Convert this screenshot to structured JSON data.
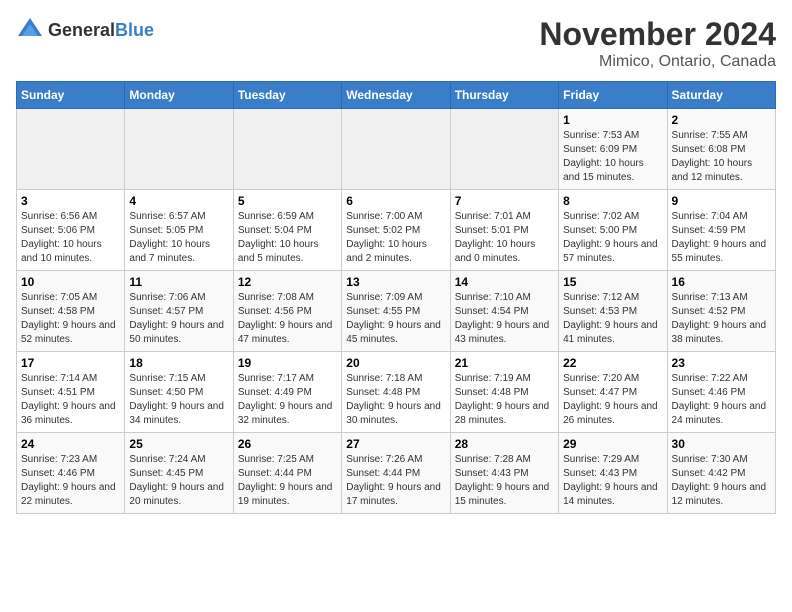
{
  "header": {
    "logo_general": "General",
    "logo_blue": "Blue",
    "month": "November 2024",
    "location": "Mimico, Ontario, Canada"
  },
  "days_of_week": [
    "Sunday",
    "Monday",
    "Tuesday",
    "Wednesday",
    "Thursday",
    "Friday",
    "Saturday"
  ],
  "weeks": [
    [
      {
        "day": "",
        "empty": true
      },
      {
        "day": "",
        "empty": true
      },
      {
        "day": "",
        "empty": true
      },
      {
        "day": "",
        "empty": true
      },
      {
        "day": "",
        "empty": true
      },
      {
        "day": "1",
        "sunrise": "Sunrise: 7:53 AM",
        "sunset": "Sunset: 6:09 PM",
        "daylight": "Daylight: 10 hours and 15 minutes."
      },
      {
        "day": "2",
        "sunrise": "Sunrise: 7:55 AM",
        "sunset": "Sunset: 6:08 PM",
        "daylight": "Daylight: 10 hours and 12 minutes."
      }
    ],
    [
      {
        "day": "3",
        "sunrise": "Sunrise: 6:56 AM",
        "sunset": "Sunset: 5:06 PM",
        "daylight": "Daylight: 10 hours and 10 minutes."
      },
      {
        "day": "4",
        "sunrise": "Sunrise: 6:57 AM",
        "sunset": "Sunset: 5:05 PM",
        "daylight": "Daylight: 10 hours and 7 minutes."
      },
      {
        "day": "5",
        "sunrise": "Sunrise: 6:59 AM",
        "sunset": "Sunset: 5:04 PM",
        "daylight": "Daylight: 10 hours and 5 minutes."
      },
      {
        "day": "6",
        "sunrise": "Sunrise: 7:00 AM",
        "sunset": "Sunset: 5:02 PM",
        "daylight": "Daylight: 10 hours and 2 minutes."
      },
      {
        "day": "7",
        "sunrise": "Sunrise: 7:01 AM",
        "sunset": "Sunset: 5:01 PM",
        "daylight": "Daylight: 10 hours and 0 minutes."
      },
      {
        "day": "8",
        "sunrise": "Sunrise: 7:02 AM",
        "sunset": "Sunset: 5:00 PM",
        "daylight": "Daylight: 9 hours and 57 minutes."
      },
      {
        "day": "9",
        "sunrise": "Sunrise: 7:04 AM",
        "sunset": "Sunset: 4:59 PM",
        "daylight": "Daylight: 9 hours and 55 minutes."
      }
    ],
    [
      {
        "day": "10",
        "sunrise": "Sunrise: 7:05 AM",
        "sunset": "Sunset: 4:58 PM",
        "daylight": "Daylight: 9 hours and 52 minutes."
      },
      {
        "day": "11",
        "sunrise": "Sunrise: 7:06 AM",
        "sunset": "Sunset: 4:57 PM",
        "daylight": "Daylight: 9 hours and 50 minutes."
      },
      {
        "day": "12",
        "sunrise": "Sunrise: 7:08 AM",
        "sunset": "Sunset: 4:56 PM",
        "daylight": "Daylight: 9 hours and 47 minutes."
      },
      {
        "day": "13",
        "sunrise": "Sunrise: 7:09 AM",
        "sunset": "Sunset: 4:55 PM",
        "daylight": "Daylight: 9 hours and 45 minutes."
      },
      {
        "day": "14",
        "sunrise": "Sunrise: 7:10 AM",
        "sunset": "Sunset: 4:54 PM",
        "daylight": "Daylight: 9 hours and 43 minutes."
      },
      {
        "day": "15",
        "sunrise": "Sunrise: 7:12 AM",
        "sunset": "Sunset: 4:53 PM",
        "daylight": "Daylight: 9 hours and 41 minutes."
      },
      {
        "day": "16",
        "sunrise": "Sunrise: 7:13 AM",
        "sunset": "Sunset: 4:52 PM",
        "daylight": "Daylight: 9 hours and 38 minutes."
      }
    ],
    [
      {
        "day": "17",
        "sunrise": "Sunrise: 7:14 AM",
        "sunset": "Sunset: 4:51 PM",
        "daylight": "Daylight: 9 hours and 36 minutes."
      },
      {
        "day": "18",
        "sunrise": "Sunrise: 7:15 AM",
        "sunset": "Sunset: 4:50 PM",
        "daylight": "Daylight: 9 hours and 34 minutes."
      },
      {
        "day": "19",
        "sunrise": "Sunrise: 7:17 AM",
        "sunset": "Sunset: 4:49 PM",
        "daylight": "Daylight: 9 hours and 32 minutes."
      },
      {
        "day": "20",
        "sunrise": "Sunrise: 7:18 AM",
        "sunset": "Sunset: 4:48 PM",
        "daylight": "Daylight: 9 hours and 30 minutes."
      },
      {
        "day": "21",
        "sunrise": "Sunrise: 7:19 AM",
        "sunset": "Sunset: 4:48 PM",
        "daylight": "Daylight: 9 hours and 28 minutes."
      },
      {
        "day": "22",
        "sunrise": "Sunrise: 7:20 AM",
        "sunset": "Sunset: 4:47 PM",
        "daylight": "Daylight: 9 hours and 26 minutes."
      },
      {
        "day": "23",
        "sunrise": "Sunrise: 7:22 AM",
        "sunset": "Sunset: 4:46 PM",
        "daylight": "Daylight: 9 hours and 24 minutes."
      }
    ],
    [
      {
        "day": "24",
        "sunrise": "Sunrise: 7:23 AM",
        "sunset": "Sunset: 4:46 PM",
        "daylight": "Daylight: 9 hours and 22 minutes."
      },
      {
        "day": "25",
        "sunrise": "Sunrise: 7:24 AM",
        "sunset": "Sunset: 4:45 PM",
        "daylight": "Daylight: 9 hours and 20 minutes."
      },
      {
        "day": "26",
        "sunrise": "Sunrise: 7:25 AM",
        "sunset": "Sunset: 4:44 PM",
        "daylight": "Daylight: 9 hours and 19 minutes."
      },
      {
        "day": "27",
        "sunrise": "Sunrise: 7:26 AM",
        "sunset": "Sunset: 4:44 PM",
        "daylight": "Daylight: 9 hours and 17 minutes."
      },
      {
        "day": "28",
        "sunrise": "Sunrise: 7:28 AM",
        "sunset": "Sunset: 4:43 PM",
        "daylight": "Daylight: 9 hours and 15 minutes."
      },
      {
        "day": "29",
        "sunrise": "Sunrise: 7:29 AM",
        "sunset": "Sunset: 4:43 PM",
        "daylight": "Daylight: 9 hours and 14 minutes."
      },
      {
        "day": "30",
        "sunrise": "Sunrise: 7:30 AM",
        "sunset": "Sunset: 4:42 PM",
        "daylight": "Daylight: 9 hours and 12 minutes."
      }
    ]
  ]
}
